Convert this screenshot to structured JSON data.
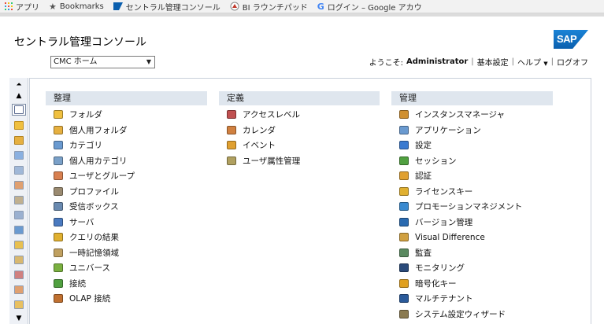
{
  "bookmarks": [
    {
      "label": "アプリ",
      "icon": "apps-grid-icon"
    },
    {
      "label": "Bookmarks",
      "icon": "star-icon"
    },
    {
      "label": "セントラル管理コンソール",
      "icon": "sap-favicon"
    },
    {
      "label": "BI ラウンチパッド",
      "icon": "bi-launchpad-icon"
    },
    {
      "label": "ログイン – Google アカウ",
      "icon": "google-icon"
    }
  ],
  "header": {
    "title": "セントラル管理コンソール",
    "logo_text": "SAP",
    "view_select": "CMC ホーム",
    "welcome_prefix": "ようこそ:",
    "user": "Administrator",
    "preferences": "基本設定",
    "help": "ヘルプ",
    "logoff": "ログオフ"
  },
  "colors": {
    "accent": "#0a5fae",
    "column_header": "#dfe6ee",
    "toolbar_bg": "#eef1f6"
  },
  "columns": [
    {
      "heading": "整理",
      "items": [
        {
          "label": "フォルダ",
          "icon": "folder-icon",
          "color": "#f0c040"
        },
        {
          "label": "個人用フォルダ",
          "icon": "personal-folder-icon",
          "color": "#e6b040"
        },
        {
          "label": "カテゴリ",
          "icon": "categories-icon",
          "color": "#6a9ad0"
        },
        {
          "label": "個人用カテゴリ",
          "icon": "personal-categories-icon",
          "color": "#7aa0c8"
        },
        {
          "label": "ユーザとグループ",
          "icon": "users-groups-icon",
          "color": "#d88050"
        },
        {
          "label": "プロファイル",
          "icon": "profiles-icon",
          "color": "#9a8a70"
        },
        {
          "label": "受信ボックス",
          "icon": "inbox-icon",
          "color": "#6a8ab0"
        },
        {
          "label": "サーバ",
          "icon": "servers-icon",
          "color": "#4a7ac0"
        },
        {
          "label": "クエリの結果",
          "icon": "query-results-icon",
          "color": "#e0b030"
        },
        {
          "label": "一時記憶領域",
          "icon": "temporary-storage-icon",
          "color": "#c0a060"
        },
        {
          "label": "ユニバース",
          "icon": "universes-icon",
          "color": "#7ab040"
        },
        {
          "label": "接続",
          "icon": "connections-icon",
          "color": "#50a040"
        },
        {
          "label": "OLAP 接続",
          "icon": "olap-connections-icon",
          "color": "#c07030"
        }
      ]
    },
    {
      "heading": "定義",
      "items": [
        {
          "label": "アクセスレベル",
          "icon": "access-levels-icon",
          "color": "#c05050"
        },
        {
          "label": "カレンダ",
          "icon": "calendars-icon",
          "color": "#d08040"
        },
        {
          "label": "イベント",
          "icon": "events-icon",
          "color": "#e0a030"
        },
        {
          "label": "ユーザ属性管理",
          "icon": "user-attribute-icon",
          "color": "#b0a060"
        }
      ]
    },
    {
      "heading": "管理",
      "items": [
        {
          "label": "インスタンスマネージャ",
          "icon": "instance-manager-icon",
          "color": "#d09030"
        },
        {
          "label": "アプリケーション",
          "icon": "applications-icon",
          "color": "#6a9ad0"
        },
        {
          "label": "設定",
          "icon": "settings-icon",
          "color": "#3a7ad0"
        },
        {
          "label": "セッション",
          "icon": "sessions-icon",
          "color": "#50a040"
        },
        {
          "label": "認証",
          "icon": "authentication-icon",
          "color": "#e0a030"
        },
        {
          "label": "ライセンスキー",
          "icon": "license-keys-icon",
          "color": "#e0b030"
        },
        {
          "label": "プロモーションマネジメント",
          "icon": "promotion-management-icon",
          "color": "#3a8ad0"
        },
        {
          "label": "バージョン管理",
          "icon": "version-management-icon",
          "color": "#2a6ab0"
        },
        {
          "label": "Visual Difference",
          "icon": "visual-difference-icon",
          "color": "#d0a040"
        },
        {
          "label": "監査",
          "icon": "auditing-icon",
          "color": "#5a8a60"
        },
        {
          "label": "モニタリング",
          "icon": "monitoring-icon",
          "color": "#2a4a7a"
        },
        {
          "label": "暗号化キー",
          "icon": "encryption-keys-icon",
          "color": "#e0a020"
        },
        {
          "label": "マルチテナント",
          "icon": "multitenancy-icon",
          "color": "#2a5a9a"
        },
        {
          "label": "システム設定ウィザード",
          "icon": "system-wizard-icon",
          "color": "#8a7a50"
        }
      ]
    }
  ]
}
